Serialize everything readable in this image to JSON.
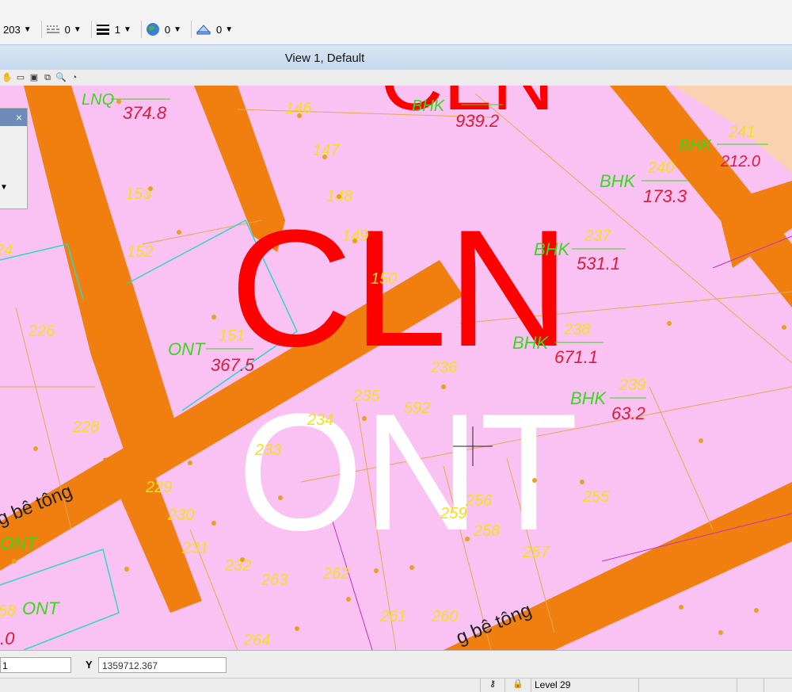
{
  "toolbar": {
    "items": [
      {
        "value": "203",
        "icon": "level-icon"
      },
      {
        "value": "0",
        "icon": "line-style-icon"
      },
      {
        "value": "1",
        "icon": "line-weight-icon"
      },
      {
        "value": "0",
        "icon": "globe-color-icon"
      },
      {
        "value": "0",
        "icon": "transparency-icon"
      }
    ]
  },
  "view": {
    "title": "View 1, Default"
  },
  "map": {
    "big_labels": [
      "CLN",
      "ONT"
    ],
    "road_labels": [
      "g bê tông",
      "g bê tông"
    ],
    "parcels": [
      {
        "code": "LNQ",
        "area": "374.8"
      },
      {
        "code": "BHK",
        "area": "939.2"
      },
      {
        "code": "BHK",
        "area": "212.0",
        "num": "241"
      },
      {
        "code": "BHK",
        "area": "173.3",
        "num": "240"
      },
      {
        "code": "BHK",
        "area": "531.1",
        "num": "237"
      },
      {
        "code": "BHK",
        "area": "671.1",
        "num": "238"
      },
      {
        "code": "BHK",
        "area": "63.2",
        "num": "239"
      },
      {
        "code": "ONT",
        "area": "367.5",
        "num": "151"
      },
      {
        "code": "ONT",
        "area": "",
        "num": ""
      },
      {
        "code": "ONT",
        "area": ".0",
        "num": "58"
      }
    ],
    "numbers": [
      "146",
      "147",
      "148",
      "149",
      "150",
      "153",
      "152",
      "226",
      "228",
      "229",
      "230",
      "231",
      "232",
      "233",
      "234",
      "235",
      "236",
      "592",
      "256",
      "259",
      "258",
      "257",
      "255",
      "263",
      "262",
      "261",
      "260",
      "264",
      "24"
    ]
  },
  "dialog": {
    "close": "×"
  },
  "status": {
    "x_value": "1",
    "y_label": "Y",
    "y_value": "1359712.367",
    "level": "Level 29"
  }
}
